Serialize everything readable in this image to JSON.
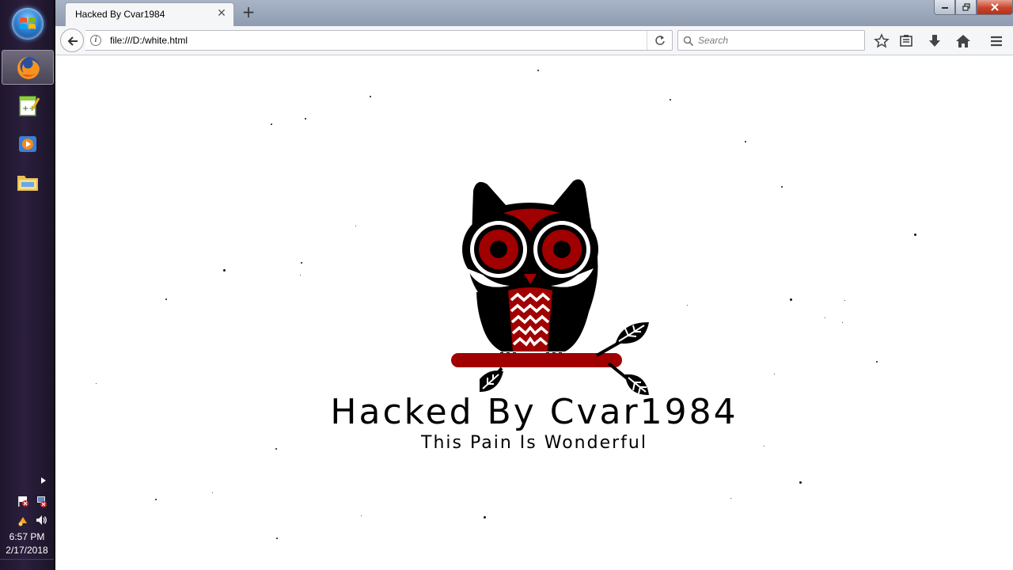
{
  "taskbar": {
    "pinned": [
      {
        "name": "firefox-icon",
        "active": true
      },
      {
        "name": "notepad-plus-plus-icon",
        "active": false
      },
      {
        "name": "media-player-icon",
        "active": false
      },
      {
        "name": "file-explorer-icon",
        "active": false
      }
    ],
    "clock_time": "6:57 PM",
    "clock_date": "2/17/2018"
  },
  "browser": {
    "tab_title": "Hacked By Cvar1984",
    "url": "file:///D:/white.html",
    "search_placeholder": "Search",
    "toolbar_icons": [
      "bookmark-star-icon",
      "reading-list-icon",
      "downloads-icon",
      "home-icon",
      "menu-icon"
    ]
  },
  "page": {
    "headline": "Hacked By Cvar1984",
    "subline": "This Pain Is Wonderful",
    "colors": {
      "owl_dark": "#000000",
      "owl_red": "#a00000",
      "background": "#ffffff"
    }
  }
}
